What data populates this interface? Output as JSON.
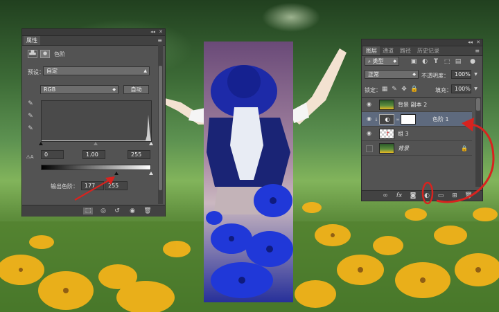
{
  "properties_panel": {
    "tab": "属性",
    "header_title": "色阶",
    "preset_label": "预设：",
    "preset_value": "自定",
    "channel_value": "RGB",
    "auto_button": "自动",
    "input_black": "0",
    "input_gamma": "1.00",
    "input_white": "255",
    "output_label": "输出色阶：",
    "output_black": "177",
    "output_white": "255"
  },
  "layers_panel": {
    "tabs": [
      "图层",
      "通道",
      "路径",
      "历史记录"
    ],
    "filter_kind": "类型",
    "blend_mode": "正常",
    "opacity_label": "不透明度：",
    "opacity_value": "100%",
    "lock_label": "锁定：",
    "fill_label": "填充：",
    "fill_value": "100%",
    "layers": [
      {
        "name": "背景 副本 2",
        "visible": true
      },
      {
        "name": "色阶 1",
        "visible": true,
        "selected": true
      },
      {
        "name": "组 3",
        "visible": true
      },
      {
        "name": "背景",
        "visible": false,
        "locked": true
      }
    ]
  },
  "colors": {
    "panel_bg": "#535353",
    "selected_layer": "#5e6a7e",
    "annotation_red": "#d8231f",
    "flower_yellow": "#f2b21a"
  }
}
